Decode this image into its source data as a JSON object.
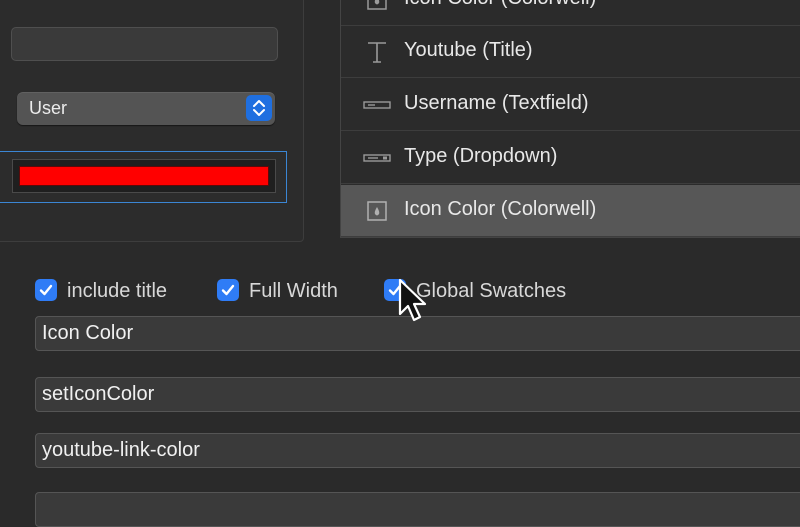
{
  "preview": {
    "popup_value": "User",
    "color_well_color": "#ff0000"
  },
  "field_list": {
    "items": [
      {
        "label": "Icon Color (Colorwell)",
        "icon": "colorwell-icon"
      },
      {
        "label": "Youtube (Title)",
        "icon": "title-icon"
      },
      {
        "label": "Username (Textfield)",
        "icon": "textfield-icon"
      },
      {
        "label": "Type (Dropdown)",
        "icon": "dropdown-icon"
      },
      {
        "label": "Icon Color (Colorwell)",
        "icon": "colorwell-icon",
        "selected": true
      }
    ]
  },
  "options": {
    "include_title": {
      "label": "include title",
      "checked": true
    },
    "full_width": {
      "label": "Full Width",
      "checked": true
    },
    "global_swatches": {
      "label": "Global Swatches",
      "checked": true
    }
  },
  "fields": {
    "title_value": "Icon Color",
    "setter_value": "setIconColor",
    "key_value": "youtube-link-color",
    "fourth_value": ""
  },
  "colors": {
    "accent": "#2f7cf6",
    "selection": "#575757",
    "focus_ring": "#3b86d4"
  }
}
